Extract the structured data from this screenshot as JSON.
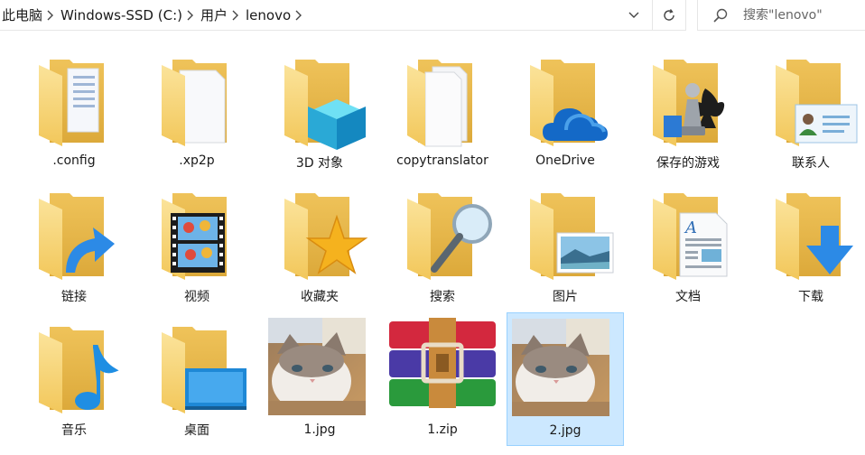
{
  "breadcrumb": {
    "items": [
      "此电脑",
      "Windows-SSD (C:)",
      "用户",
      "lenovo"
    ]
  },
  "search": {
    "placeholder": "搜索\"lenovo\""
  },
  "items": [
    {
      "label": ".config",
      "icon": "folder-document-icon"
    },
    {
      "label": ".xp2p",
      "icon": "folder-blank-page-icon"
    },
    {
      "label": "3D 对象",
      "icon": "folder-3d-objects-icon"
    },
    {
      "label": "copytranslator",
      "icon": "folder-pages-icon"
    },
    {
      "label": "OneDrive",
      "icon": "onedrive-cloud-icon"
    },
    {
      "label": "保存的游戏",
      "icon": "saved-games-icon"
    },
    {
      "label": "联系人",
      "icon": "contacts-icon"
    },
    {
      "label": "链接",
      "icon": "links-arrow-icon"
    },
    {
      "label": "视频",
      "icon": "videos-filmstrip-icon"
    },
    {
      "label": "收藏夹",
      "icon": "favorites-star-icon"
    },
    {
      "label": "搜索",
      "icon": "searches-magnifier-icon"
    },
    {
      "label": "图片",
      "icon": "pictures-icon"
    },
    {
      "label": "文档",
      "icon": "documents-icon"
    },
    {
      "label": "下载",
      "icon": "downloads-arrow-icon"
    },
    {
      "label": "音乐",
      "icon": "music-note-icon"
    },
    {
      "label": "桌面",
      "icon": "desktop-monitor-icon"
    },
    {
      "label": "1.jpg",
      "icon": "cat-photo-thumbnail"
    },
    {
      "label": "1.zip",
      "icon": "winrar-archive-icon"
    },
    {
      "label": "2.jpg",
      "icon": "cat-photo-thumbnail",
      "selected": true
    }
  ],
  "colors": {
    "folder_back": "#e9b94a",
    "folder_front": "#f8d775",
    "selection": "#cce8ff",
    "selection_border": "#99d1ff"
  }
}
